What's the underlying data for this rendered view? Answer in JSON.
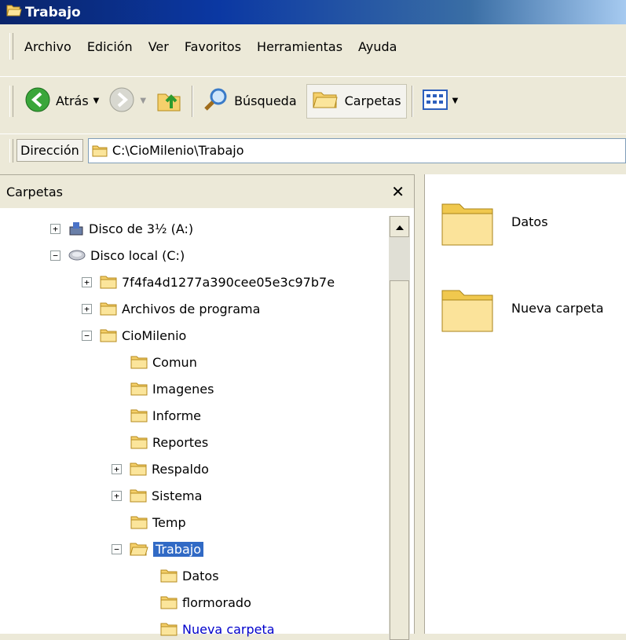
{
  "window": {
    "title": "Trabajo"
  },
  "menu": [
    "Archivo",
    "Edición",
    "Ver",
    "Favoritos",
    "Herramientas",
    "Ayuda"
  ],
  "toolbar": {
    "back_label": "Atrás",
    "search_label": "Búsqueda",
    "folders_label": "Carpetas"
  },
  "address": {
    "label": "Dirección",
    "value": "C:\\CioMilenio\\Trabajo"
  },
  "folders_panel": {
    "title": "Carpetas"
  },
  "tree": [
    {
      "label": "Disco de 3½ (A:)",
      "expander": "+",
      "icon": "floppy-icon"
    },
    {
      "label": "Disco local (C:)",
      "expander": "−",
      "icon": "hard-drive-icon"
    },
    {
      "label": "7f4fa4d1277a390cee05e3c97b7e",
      "expander": "+",
      "icon": "folder-icon"
    },
    {
      "label": "Archivos de programa",
      "expander": "+",
      "icon": "folder-icon"
    },
    {
      "label": "CioMilenio",
      "expander": "−",
      "icon": "folder-icon"
    },
    {
      "label": "Comun",
      "expander": "",
      "icon": "folder-icon"
    },
    {
      "label": "Imagenes",
      "expander": "",
      "icon": "folder-icon"
    },
    {
      "label": "Informe",
      "expander": "",
      "icon": "folder-icon"
    },
    {
      "label": "Reportes",
      "expander": "",
      "icon": "folder-icon"
    },
    {
      "label": "Respaldo",
      "expander": "+",
      "icon": "folder-icon"
    },
    {
      "label": "Sistema",
      "expander": "+",
      "icon": "folder-icon"
    },
    {
      "label": "Temp",
      "expander": "",
      "icon": "folder-icon"
    },
    {
      "label": "Trabajo",
      "expander": "−",
      "icon": "open-folder-icon"
    },
    {
      "label": "Datos",
      "expander": "",
      "icon": "folder-icon"
    },
    {
      "label": "flormorado",
      "expander": "",
      "icon": "folder-icon"
    },
    {
      "label": "Nueva carpeta",
      "expander": "",
      "icon": "folder-icon"
    }
  ],
  "content": [
    {
      "label": "Datos",
      "icon": "large-folder-icon"
    },
    {
      "label": "Nueva carpeta",
      "icon": "large-folder-icon"
    }
  ]
}
